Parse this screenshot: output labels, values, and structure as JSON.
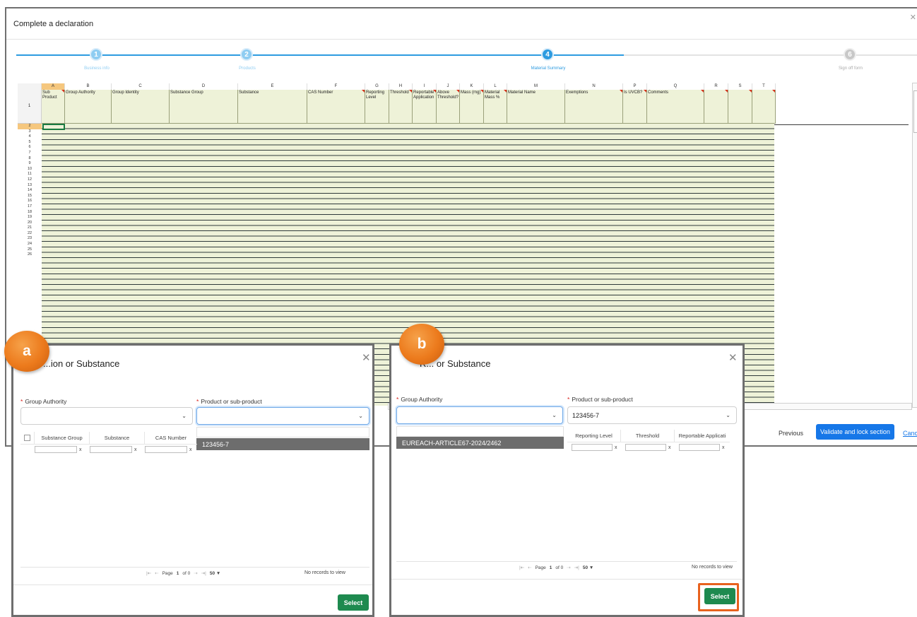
{
  "window": {
    "title": "Complete a declaration"
  },
  "stepper": {
    "steps": [
      {
        "number": "1",
        "label": "Business info"
      },
      {
        "number": "2",
        "label": "Products"
      },
      {
        "number": "4",
        "label": "Material Summary"
      },
      {
        "number": "6",
        "label": "Sign off form"
      }
    ]
  },
  "sheet": {
    "columns": [
      {
        "letter": "A",
        "header": "Sub Product"
      },
      {
        "letter": "B",
        "header": "Group Authority"
      },
      {
        "letter": "C",
        "header": "Group Identity"
      },
      {
        "letter": "D",
        "header": "Substance Group"
      },
      {
        "letter": "E",
        "header": "Substance"
      },
      {
        "letter": "F",
        "header": "CAS Number"
      },
      {
        "letter": "G",
        "header": "Reporting Level"
      },
      {
        "letter": "H",
        "header": "Threshold"
      },
      {
        "letter": "I",
        "header": "Reportable Application"
      },
      {
        "letter": "J",
        "header": "Above Threshold?"
      },
      {
        "letter": "K",
        "header": "Mass (mg)"
      },
      {
        "letter": "L",
        "header": "Material Mass %"
      },
      {
        "letter": "M",
        "header": "Material Name"
      },
      {
        "letter": "N",
        "header": "Exemptions"
      },
      {
        "letter": "P",
        "header": "Is UVCB?"
      },
      {
        "letter": "Q",
        "header": "Comments"
      },
      {
        "letter": "R",
        "header": ""
      },
      {
        "letter": "S",
        "header": ""
      },
      {
        "letter": "T",
        "header": ""
      }
    ],
    "row_numbers": [
      "1",
      "2",
      "3",
      "4",
      "5",
      "6",
      "7",
      "8",
      "9",
      "10",
      "11",
      "12",
      "13",
      "14",
      "15",
      "16",
      "17",
      "18",
      "19",
      "20",
      "21",
      "22",
      "23",
      "24",
      "25",
      "26"
    ]
  },
  "footer": {
    "previous_label": "Previous",
    "validate_label": "Validate and lock section",
    "cancel_label": "Cancel"
  },
  "modal_a": {
    "badge": "a",
    "title": "...ion or Substance",
    "group_authority_label": "Group Authority",
    "product_label": "Product or sub-product",
    "group_authority_value": "",
    "product_value": "",
    "dropdown_option": "123456-7",
    "grid_headers": [
      "Substance Group",
      "Substance",
      "CAS Number"
    ],
    "filter_clear": "x",
    "pager": {
      "page_label": "Page",
      "page": "1",
      "of_label": "of 0",
      "per_page": "50"
    },
    "no_records": "No records to view",
    "select_label": "Select"
  },
  "modal_b": {
    "badge": "b",
    "title": "R... or Substance",
    "group_authority_label": "Group Authority",
    "product_label": "Product or sub-product",
    "group_authority_value": "",
    "product_value": "123456-7",
    "dropdown_option": "EUREACH-ARTICLE67-2024/2462",
    "grid_headers": [
      "Reporting Level",
      "Threshold",
      "Reportable Applicati"
    ],
    "filter_clear": "x",
    "pager": {
      "page_label": "Page",
      "page": "1",
      "of_label": "of 0",
      "per_page": "50"
    },
    "no_records": "No records to view",
    "select_label": "Select"
  },
  "colors": {
    "accent": "#1677e8",
    "select_green": "#1e8a4f",
    "badge_orange": "#ec7a1c",
    "highlight_outline": "#e8621e",
    "sheet_fill": "#eef2d8"
  }
}
